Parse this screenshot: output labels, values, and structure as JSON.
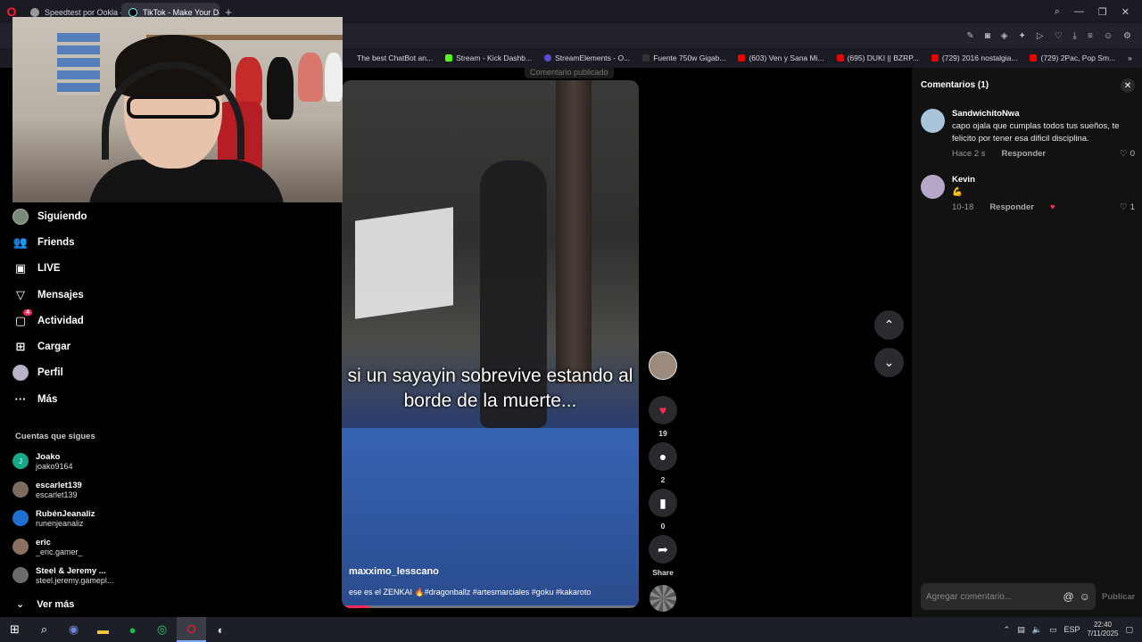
{
  "browser": {
    "tabs": [
      {
        "label": "Speedtest por Ookla - La",
        "active": false
      },
      {
        "label": "TikTok - Make Your Day",
        "active": true
      }
    ],
    "new_tab": "+",
    "bookmarks": [
      {
        "label": "The best ChatBot an...",
        "icon": "chatbot-icon"
      },
      {
        "label": "Stream - Kick Dashb...",
        "icon": "kick-icon"
      },
      {
        "label": "StreamElements - O...",
        "icon": "streamelements-icon"
      },
      {
        "label": "Fuente 750w Gigab...",
        "icon": "store-icon"
      },
      {
        "label": "(603) Ven y Sana Mi...",
        "icon": "youtube-icon"
      },
      {
        "label": "(695) DUKI || BZRP...",
        "icon": "youtube-icon"
      },
      {
        "label": "(729) 2016 nostalgia...",
        "icon": "youtube-icon"
      },
      {
        "label": "(729) 2Pac, Pop Sm...",
        "icon": "youtube-icon"
      }
    ]
  },
  "sidebar": {
    "nav": [
      {
        "label": "Siguiendo",
        "icon": "following-avatar-icon"
      },
      {
        "label": "Friends",
        "icon": "friends-icon"
      },
      {
        "label": "LIVE",
        "icon": "live-icon"
      },
      {
        "label": "Mensajes",
        "icon": "messages-icon"
      },
      {
        "label": "Actividad",
        "icon": "activity-icon",
        "badge": "4"
      },
      {
        "label": "Cargar",
        "icon": "upload-icon"
      },
      {
        "label": "Perfil",
        "icon": "profile-icon"
      },
      {
        "label": "Más",
        "icon": "more-icon"
      }
    ],
    "following_title": "Cuentas que sigues",
    "accounts": [
      {
        "name": "Joako",
        "handle": "joako9164",
        "avatar_letter": "J",
        "color": "#17a889"
      },
      {
        "name": "escarlet139",
        "handle": "escarlet139",
        "avatar_letter": "",
        "color": "#7d6b5e"
      },
      {
        "name": "RubénJeanaliz",
        "handle": "runenjeanaliz",
        "avatar_letter": "",
        "color": "#1f6fd1"
      },
      {
        "name": "eric",
        "handle": "_eric.gamer_",
        "avatar_letter": "",
        "color": "#8a7060"
      },
      {
        "name": "Steel & Jeremy ...",
        "handle": "steel.jeremy.gamepl...",
        "avatar_letter": "",
        "color": "#6b6b6b"
      }
    ],
    "see_more": "Ver más"
  },
  "video": {
    "toast": "Comentario publicado",
    "caption": "si un sayayin sobrevive estando al borde de la muerte...",
    "author": "maxximo_lesscano",
    "description": "ese es el ZENKAI 🔥#dragonballz #artesmarciales #goku #kakaroto",
    "progress": 0.08
  },
  "rail": {
    "likes": "19",
    "comments": "2",
    "saves": "0",
    "share": "Share"
  },
  "comments_panel": {
    "title": "Comentarios (1)",
    "items": [
      {
        "user": "SandwichitoNwa",
        "text": "capo ojala que cumplas todos tus sueños, te felicito por tener esa dificil disciplina.",
        "time": "Hace 2 s",
        "reply": "Responder",
        "likes": "0",
        "avatar_color": "#a9c3d9"
      },
      {
        "user": "Kevin",
        "text": "💪",
        "time": "10-18",
        "reply": "Responder",
        "likes": "1",
        "avatar_color": "#b6a7c9"
      }
    ],
    "input_placeholder": "Agregar comentario...",
    "post_label": "Publicar"
  },
  "taskbar": {
    "lang": "ESP",
    "time": "22:40",
    "date": "7/11/2025"
  }
}
